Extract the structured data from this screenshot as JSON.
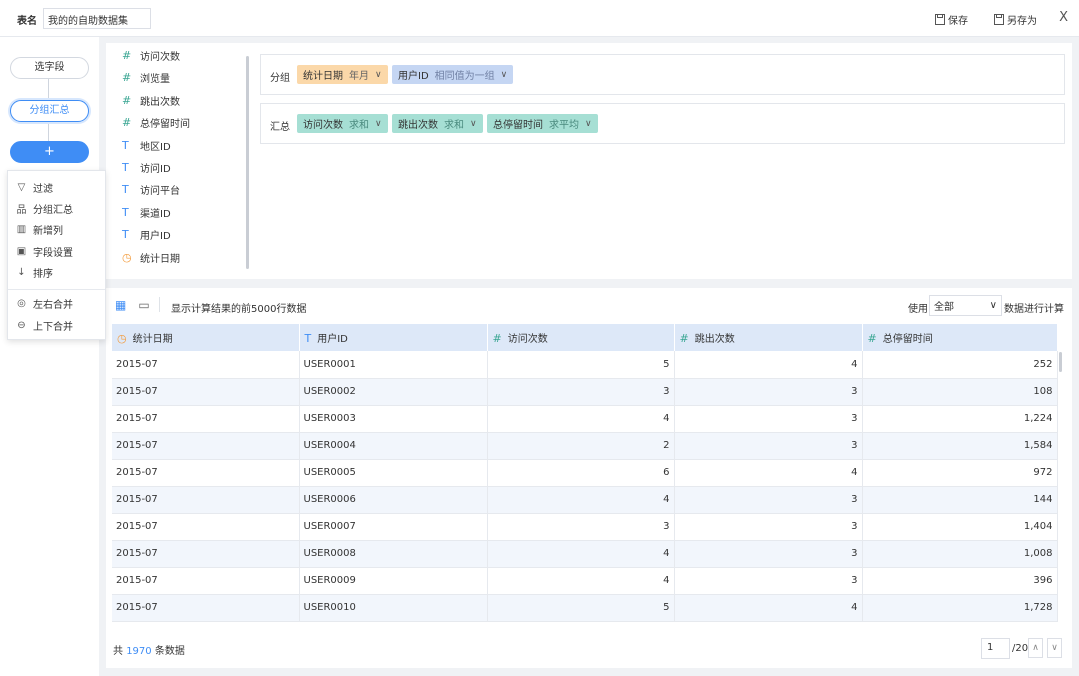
{
  "header": {
    "table_name_label": "表名",
    "table_name_value": "我的的自助数据集",
    "save_label": "保存",
    "save_as_label": "另存为",
    "close_glyph": "X"
  },
  "steps": {
    "select_fields": "选字段",
    "group_summary": "分组汇总",
    "add": "+"
  },
  "add_menu": [
    {
      "icon": "filter-icon",
      "glyph": "▽",
      "label": "过滤"
    },
    {
      "icon": "group-summary-icon",
      "glyph": "品",
      "label": "分组汇总"
    },
    {
      "icon": "new-column-icon",
      "glyph": "▥",
      "label": "新增列"
    },
    {
      "icon": "field-settings-icon",
      "glyph": "▣",
      "label": "字段设置"
    },
    {
      "icon": "sort-icon",
      "glyph": "↓",
      "label": "排序"
    },
    {
      "icon": "merge-left-right-icon",
      "glyph": "◎",
      "label": "左右合并"
    },
    {
      "icon": "merge-top-bottom-icon",
      "glyph": "⊖",
      "label": "上下合并"
    }
  ],
  "fields": [
    {
      "type": "number",
      "glyph": "#",
      "label": "访问次数"
    },
    {
      "type": "number",
      "glyph": "#",
      "label": "浏览量"
    },
    {
      "type": "number",
      "glyph": "#",
      "label": "跳出次数"
    },
    {
      "type": "number",
      "glyph": "#",
      "label": "总停留时间"
    },
    {
      "type": "text",
      "glyph": "T",
      "label": "地区ID"
    },
    {
      "type": "text",
      "glyph": "T",
      "label": "访问ID"
    },
    {
      "type": "text",
      "glyph": "T",
      "label": "访问平台"
    },
    {
      "type": "text",
      "glyph": "T",
      "label": "渠道ID"
    },
    {
      "type": "text",
      "glyph": "T",
      "label": "用户ID"
    },
    {
      "type": "date",
      "glyph": "◷",
      "label": "统计日期"
    }
  ],
  "group": {
    "label": "分组",
    "chips": [
      {
        "name": "统计日期",
        "mode": "年月",
        "color": "#fbd8a9"
      },
      {
        "name": "用户ID",
        "mode": "相同值为一组",
        "color": "#c5d6f3"
      }
    ]
  },
  "summary": {
    "label": "汇总",
    "chips": [
      {
        "name": "访问次数",
        "mode": "求和",
        "color": "#a6dfd4"
      },
      {
        "name": "跳出次数",
        "mode": "求和",
        "color": "#a6dfd4"
      },
      {
        "name": "总停留时间",
        "mode": "求平均",
        "color": "#a6dfd4"
      }
    ]
  },
  "results": {
    "info": "显示计算结果的前5000行数据",
    "use_label": "使用",
    "use_value": "全部",
    "use_suffix": "数据进行计算",
    "columns": [
      {
        "glyph": "◷",
        "type": "date",
        "label": "统计日期"
      },
      {
        "glyph": "T",
        "type": "text",
        "label": "用户ID"
      },
      {
        "glyph": "#",
        "type": "number",
        "label": "访问次数"
      },
      {
        "glyph": "#",
        "type": "number",
        "label": "跳出次数"
      },
      {
        "glyph": "#",
        "type": "number",
        "label": "总停留时间"
      }
    ],
    "rows": [
      [
        "2015-07",
        "USER0001",
        "5",
        "4",
        "252"
      ],
      [
        "2015-07",
        "USER0002",
        "3",
        "3",
        "108"
      ],
      [
        "2015-07",
        "USER0003",
        "4",
        "3",
        "1,224"
      ],
      [
        "2015-07",
        "USER0004",
        "2",
        "3",
        "1,584"
      ],
      [
        "2015-07",
        "USER0005",
        "6",
        "4",
        "972"
      ],
      [
        "2015-07",
        "USER0006",
        "4",
        "3",
        "144"
      ],
      [
        "2015-07",
        "USER0007",
        "3",
        "3",
        "1,404"
      ],
      [
        "2015-07",
        "USER0008",
        "4",
        "3",
        "1,008"
      ],
      [
        "2015-07",
        "USER0009",
        "4",
        "3",
        "396"
      ],
      [
        "2015-07",
        "USER0010",
        "5",
        "4",
        "1,728"
      ]
    ],
    "total_prefix": "共",
    "total_count": "1970",
    "total_suffix": "条数据",
    "page_current": "1",
    "page_total": "/20"
  }
}
